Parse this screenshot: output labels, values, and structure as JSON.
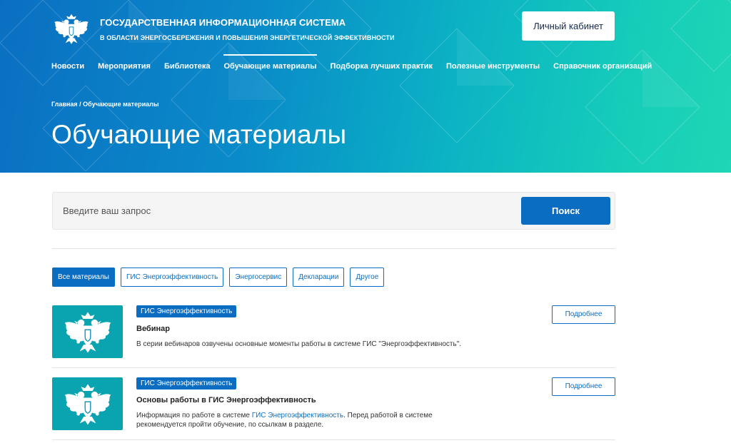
{
  "header": {
    "title": "ГОСУДАРСТВЕННАЯ ИНФОРМАЦИОННАЯ СИСТЕМА",
    "subtitle": "В ОБЛАСТИ ЭНЕРГОСБЕРЕЖЕНИЯ И ПОВЫШЕНИЯ ЭНЕРГЕТИЧЕСКОЙ ЭФФЕКТИВНОСТИ",
    "cabinet_label": "Личный кабинет",
    "emblem_icon": "double-headed-eagle-emblem"
  },
  "nav": {
    "items": [
      {
        "label": "Новости",
        "active": false
      },
      {
        "label": "Мероприятия",
        "active": false
      },
      {
        "label": "Библиотека",
        "active": false
      },
      {
        "label": "Обучающие материалы",
        "active": true
      },
      {
        "label": "Подборка лучших практик",
        "active": false
      },
      {
        "label": "Полезные инструменты",
        "active": false
      },
      {
        "label": "Справочник организаций",
        "active": false
      }
    ]
  },
  "breadcrumb": {
    "home": "Главная",
    "separator": " / ",
    "current": "Обучающие материалы"
  },
  "page_title": "Обучающие материалы",
  "search": {
    "placeholder": "Введите ваш запрос",
    "value": "",
    "button_label": "Поиск"
  },
  "filters": [
    {
      "label": "Все материалы",
      "active": true
    },
    {
      "label": "ГИС Энергоэффективность",
      "active": false
    },
    {
      "label": "Энергосервис",
      "active": false
    },
    {
      "label": "Декларации",
      "active": false
    },
    {
      "label": "Другое",
      "active": false
    }
  ],
  "materials": [
    {
      "tag": "ГИС Энергоэффективность",
      "title": "Вебинар",
      "description_before": "В серии вебинаров озвучены основные моменты работы в системе ГИС \"Энергоэффективность\".",
      "link": "",
      "description_after": "",
      "more_label": "Подробнее"
    },
    {
      "tag": "ГИС Энергоэффективность",
      "title": "Основы работы в ГИС Энергоэффективность",
      "description_before": "Информация по работе в системе ",
      "link": "ГИС Энергоэффективность",
      "description_after": ". Перед работой в системе рекомендуется пройти обучение, по ссылкам в разделе.",
      "more_label": "Подробнее"
    }
  ],
  "colors": {
    "primary": "#0b6dc2",
    "hero_start": "#0a6fc2",
    "hero_end": "#1fd6b5",
    "thumb": "#0aa3b0"
  }
}
